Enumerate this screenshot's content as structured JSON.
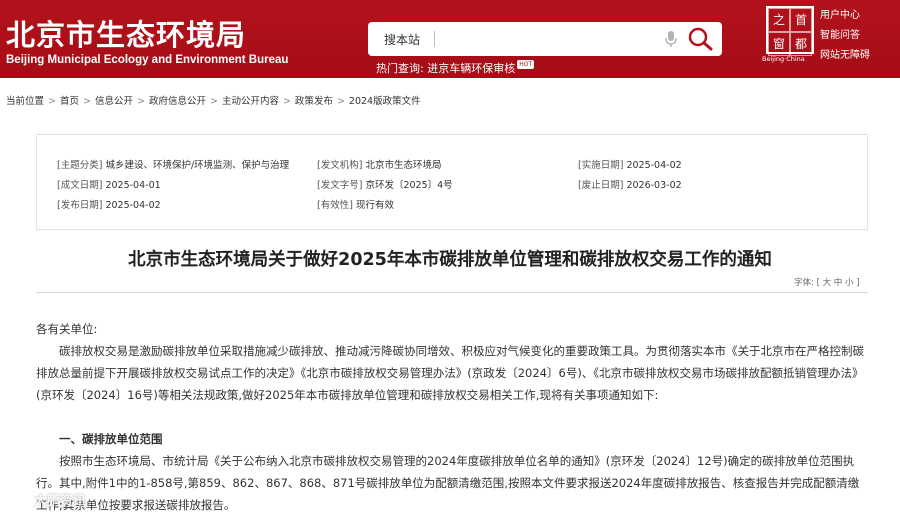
{
  "header": {
    "logo_cn": "北京市生态环境局",
    "logo_en": "Beijing Municipal Ecology and Environment Bureau",
    "search_placeholder": "搜本站",
    "hot_search_label": "热门查询:",
    "hot_search_link": "进京车辆环保审核",
    "hot_badge": "HOT",
    "seal_chars": [
      "首",
      "都",
      "之",
      "窗"
    ],
    "seal_caption": "Beijing·China",
    "top_links": [
      "用户中心",
      "智能问答",
      "网站无障碍"
    ],
    "colors": {
      "brand_red": "#b3121c"
    },
    "icons": [
      "microphone-icon",
      "magnifier-icon"
    ]
  },
  "breadcrumb": {
    "prefix": "当前位置",
    "items": [
      "首页",
      "信息公开",
      "政府信息公开",
      "主动公开内容",
      "政策发布",
      "2024版政策文件"
    ]
  },
  "meta": {
    "topic_key": "[主题分类]",
    "topic_val": "城乡建设、环境保护/环境监测、保护与治理",
    "issuer_key": "[发文机构]",
    "issuer_val": "北京市生态环境局",
    "impl_key": "[实施日期]",
    "impl_val": "2025-04-02",
    "written_key": "[成文日期]",
    "written_val": "2025-04-01",
    "docno_key": "[发文字号]",
    "docno_val": "京环发〔2025〕4号",
    "expire_key": "[废止日期]",
    "expire_val": "2026-03-02",
    "publish_key": "[发布日期]",
    "publish_val": "2025-04-02",
    "validity_key": "[有效性]",
    "validity_val": "现行有效"
  },
  "document": {
    "title": "北京市生态环境局关于做好2025年本市碳排放单位管理和碳排放权交易工作的通知",
    "font_size_bar": "字体: [ 大 中 小 ]",
    "salutation": "各有关单位:",
    "para1": "碳排放权交易是激励碳排放单位采取措施减少碳排放、推动减污降碳协同增效、积极应对气候变化的重要政策工具。为贯彻落实本市《关于北京市在严格控制碳排放总量前提下开展碳排放权交易试点工作的决定》《北京市碳排放权交易管理办法》(京政发〔2024〕6号)、《北京市碳排放权交易市场碳排放配额抵销管理办法》(京环发〔2024〕16号)等相关法规政策,做好2025年本市碳排放单位管理和碳排放权交易相关工作,现将有关事项通知如下:",
    "section1_heading": "一、碳排放单位范围",
    "para2": "按照市生态环境局、市统计局《关于公布纳入北京市碳排放权交易管理的2024年度碳排放单位名单的通知》(京环发〔2024〕12号)确定的碳排放单位范围执行。其中,附件1中的1-858号,第859、862、867、868、871号碳排放单位为配额清缴范围,按照本文件要求报送2024年度碳排放报告、核查报告并完成配额清缴工作;其余单位按要求报送碳排放报告。"
  },
  "watermark": {
    "text": "大鹏资讯"
  }
}
